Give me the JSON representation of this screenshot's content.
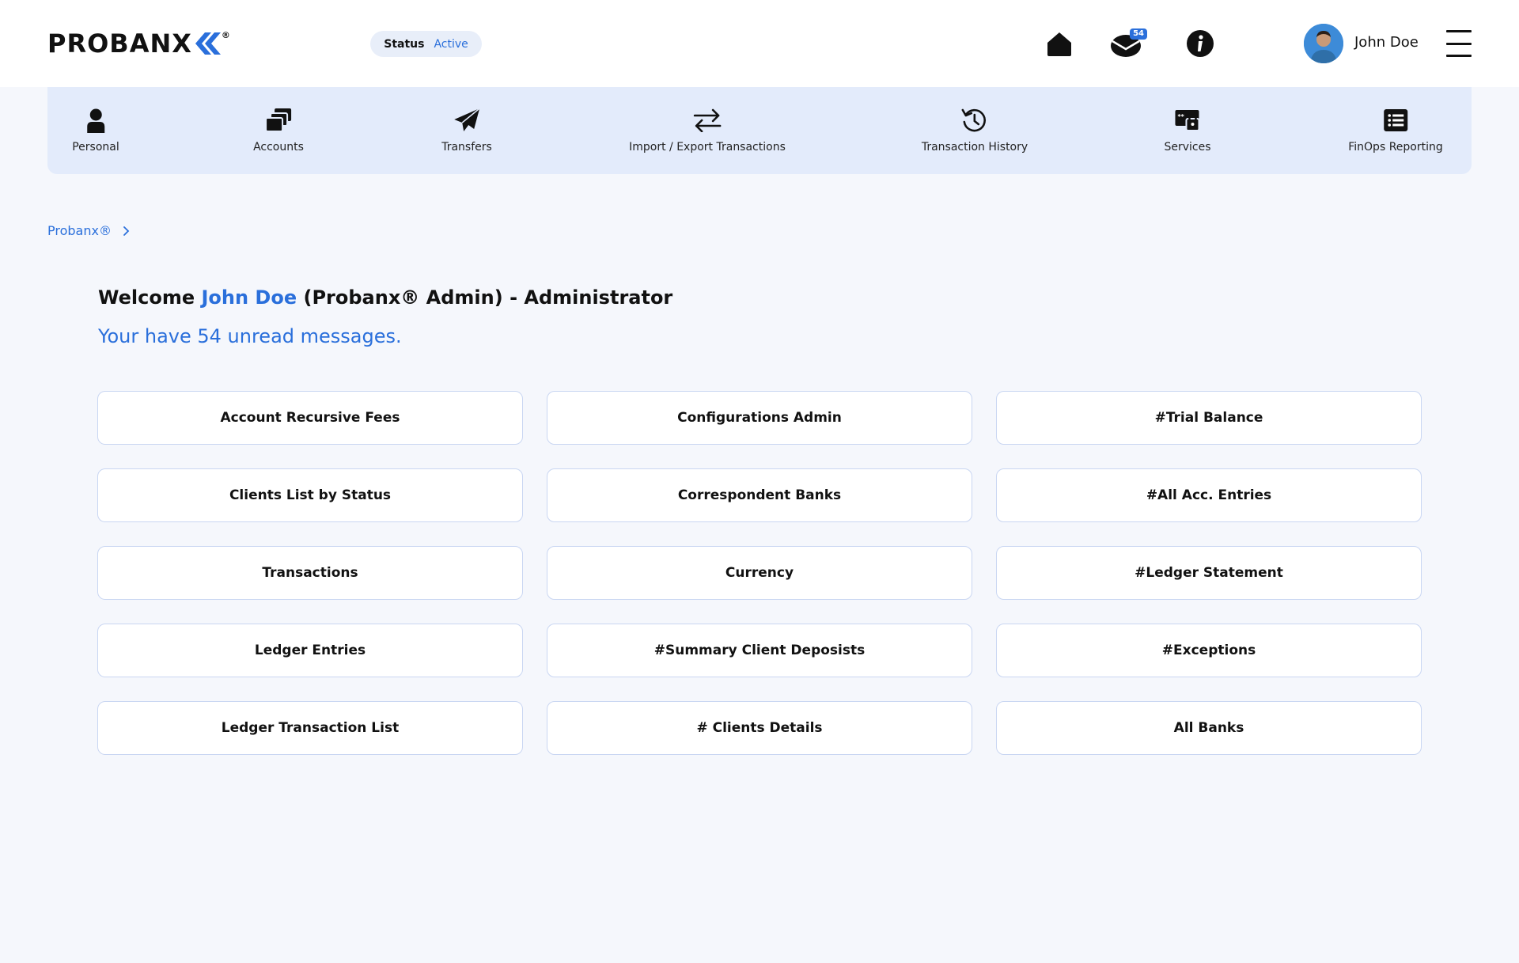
{
  "brand": {
    "logo_text": "PROBANX",
    "logo_reg": "®"
  },
  "status": {
    "label": "Status",
    "value": "Active"
  },
  "header": {
    "mail_count": "54",
    "user_name": "John Doe"
  },
  "nav": {
    "items": [
      {
        "label": "Personal",
        "icon": "person-icon"
      },
      {
        "label": "Accounts",
        "icon": "accounts-icon"
      },
      {
        "label": "Transfers",
        "icon": "paper-plane-icon"
      },
      {
        "label": "Import / Export Transactions",
        "icon": "swap-arrows-icon"
      },
      {
        "label": "Transaction History",
        "icon": "history-icon"
      },
      {
        "label": "Services",
        "icon": "services-lock-icon"
      },
      {
        "label": "FinOps Reporting",
        "icon": "report-list-icon"
      }
    ]
  },
  "breadcrumb": {
    "root": "Probanx®"
  },
  "welcome": {
    "prefix": "Welcome",
    "user": "John Doe",
    "suffix": "(Probanx® Admin) - Administrator",
    "unread": "Your have 54 unread messages."
  },
  "tiles": [
    "Account Recursive Fees",
    "Configurations Admin",
    "#Trial Balance",
    "Clients List by Status",
    "Correspondent Banks",
    "#All Acc. Entries",
    "Transactions",
    "Currency",
    "#Ledger Statement",
    "Ledger Entries",
    "#Summary Client Deposists",
    "#Exceptions",
    "Ledger Transaction List",
    "# Clients Details",
    "All Banks"
  ],
  "colors": {
    "accent": "#2a6fdb",
    "nav_bg": "#e3ebfb",
    "page_bg": "#f5f7fc"
  }
}
